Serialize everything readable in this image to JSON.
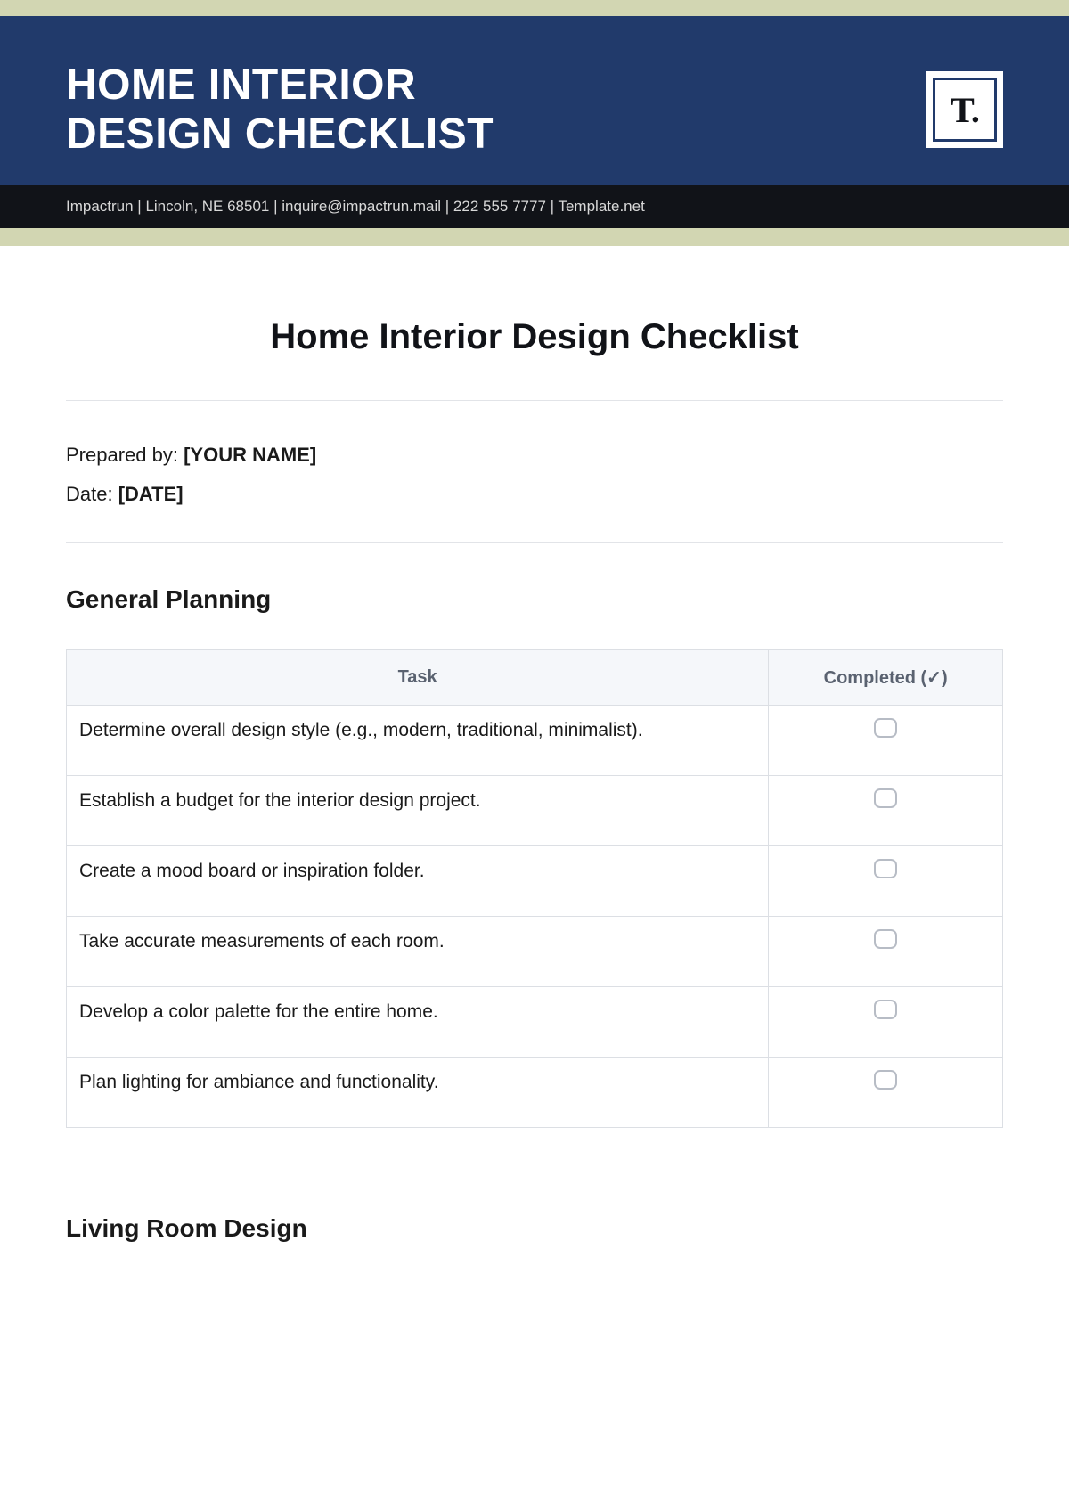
{
  "header": {
    "title_line1": "HOME INTERIOR",
    "title_line2": "DESIGN CHECKLIST",
    "logo_text": "T."
  },
  "info_bar": "Impactrun | Lincoln, NE 68501 | inquire@impactrun.mail | 222 555 7777 | Template.net",
  "doc_title": "Home Interior Design Checklist",
  "meta": {
    "prepared_label": "Prepared by: ",
    "prepared_value": "[YOUR NAME]",
    "date_label": "Date: ",
    "date_value": "[DATE]"
  },
  "sections": {
    "general_planning": {
      "title": "General Planning",
      "headers": {
        "task": "Task",
        "completed": "Completed (✓)"
      },
      "tasks": [
        "Determine overall design style (e.g., modern, traditional, minimalist).",
        "Establish a budget for the interior design project.",
        "Create a mood board or inspiration folder.",
        "Take accurate measurements of each room.",
        "Develop a color palette for the entire home.",
        "Plan lighting for ambiance and functionality."
      ]
    },
    "living_room": {
      "title": "Living Room Design"
    }
  }
}
